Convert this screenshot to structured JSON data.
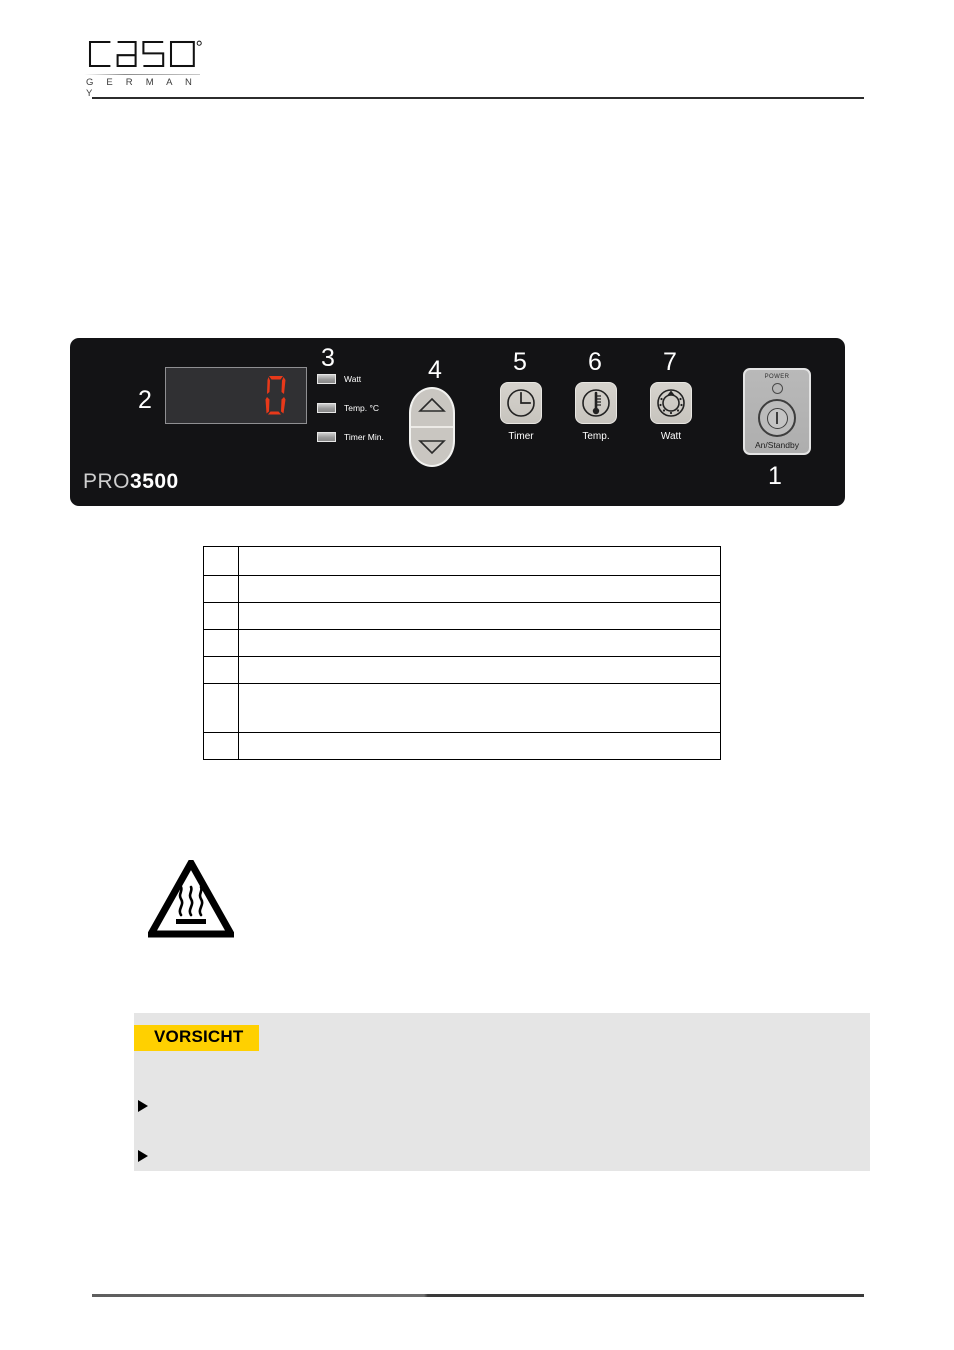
{
  "header": {
    "brand": "CASO",
    "brand_sub": "G E R M A N Y",
    "trademark": "®"
  },
  "control_panel": {
    "model_prefix": "PRO",
    "model_number": "3500",
    "display": {
      "callout": "2",
      "value": "0",
      "segment_color": "#e8391a",
      "screen_color": "#303033"
    },
    "indicators": {
      "callout": "3",
      "items": [
        {
          "label": "Watt"
        },
        {
          "label": "Temp. °C"
        },
        {
          "label": "Timer Min."
        }
      ]
    },
    "rocker": {
      "callout": "4",
      "up_label": "up-arrow",
      "down_label": "down-arrow"
    },
    "buttons": [
      {
        "callout": "5",
        "label": "Timer",
        "icon": "clock-icon"
      },
      {
        "callout": "6",
        "label": "Temp.",
        "icon": "thermometer-icon"
      },
      {
        "callout": "7",
        "label": "Watt",
        "icon": "power-dial-icon"
      }
    ],
    "power": {
      "callout": "1",
      "led_label": "POWER",
      "caption": "An/Standby"
    }
  },
  "legend_table": {
    "rows": [
      {
        "num": "",
        "desc": ""
      },
      {
        "num": "",
        "desc": ""
      },
      {
        "num": "",
        "desc": ""
      },
      {
        "num": "",
        "desc": ""
      },
      {
        "num": "",
        "desc": ""
      },
      {
        "num": "",
        "desc": ""
      },
      {
        "num": "",
        "desc": ""
      }
    ]
  },
  "hot_surface_symbol": {
    "name": "hot-surface-warning-symbol"
  },
  "caution": {
    "tag": "VORSICHT",
    "body": "",
    "items": [
      {
        "text": ""
      },
      {
        "text": ""
      }
    ],
    "tag_color": "#ffd000",
    "box_color": "#e5e5e5"
  }
}
